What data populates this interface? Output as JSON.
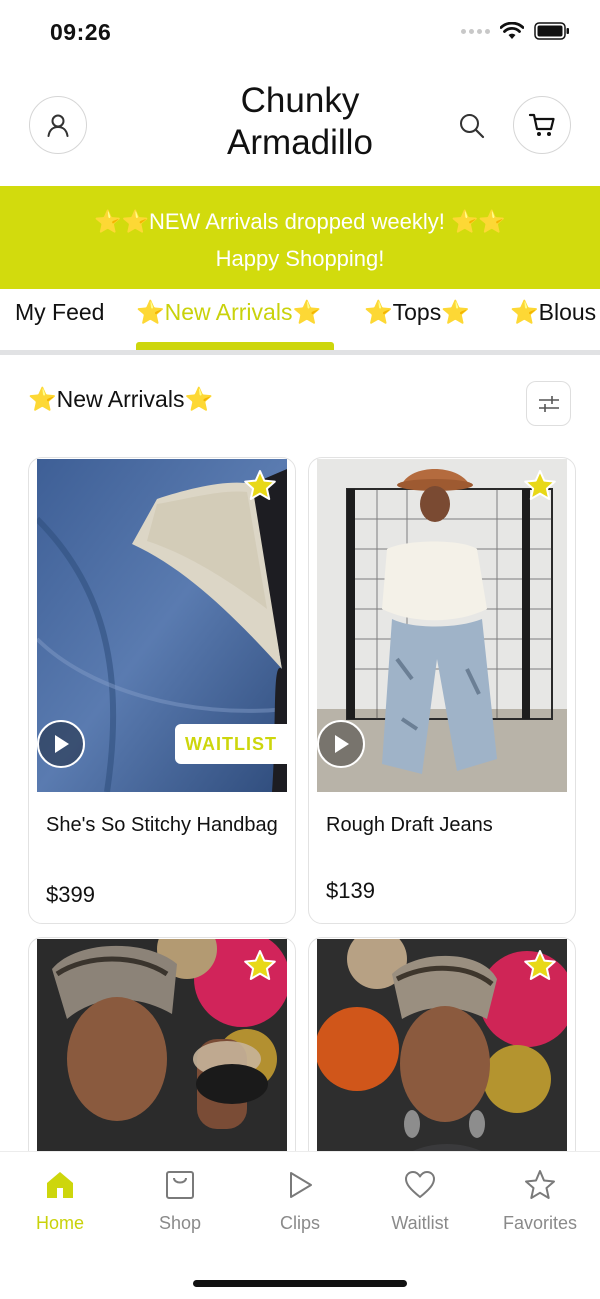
{
  "status_bar": {
    "time": "09:26"
  },
  "header": {
    "brand_line1": "Chunky",
    "brand_line2": "Armadillo",
    "icons": {
      "profile": "user-icon",
      "search": "search-icon",
      "cart": "cart-icon"
    }
  },
  "banner": {
    "line1": "⭐⭐NEW Arrivals dropped weekly! ⭐⭐",
    "line2": "Happy Shopping!",
    "background": "#d2db0d"
  },
  "tabs": [
    {
      "label": "My Feed",
      "active": false
    },
    {
      "label": "⭐New Arrivals⭐",
      "active": true
    },
    {
      "label": "⭐Tops⭐",
      "active": false
    },
    {
      "label": "⭐Blous",
      "active": false
    }
  ],
  "section": {
    "title": "⭐New Arrivals⭐"
  },
  "products": [
    {
      "name": "She's So Stitchy Handbag",
      "price": "$399",
      "badge": "WAITLIST",
      "has_video": true
    },
    {
      "name": "Rough Draft Jeans",
      "price": "$139",
      "badge": "",
      "has_video": true
    },
    {
      "name": "",
      "price": "",
      "badge": "",
      "has_video": false
    },
    {
      "name": "",
      "price": "",
      "badge": "",
      "has_video": false
    }
  ],
  "bottom_nav": [
    {
      "label": "Home",
      "icon": "home-icon",
      "active": true
    },
    {
      "label": "Shop",
      "icon": "shop-bag-icon",
      "active": false
    },
    {
      "label": "Clips",
      "icon": "play-icon",
      "active": false
    },
    {
      "label": "Waitlist",
      "icon": "heart-icon",
      "active": false
    },
    {
      "label": "Favorites",
      "icon": "star-icon",
      "active": false
    }
  ],
  "colors": {
    "accent": "#cdd60c",
    "text": "#111111",
    "muted": "#8a8a8a"
  }
}
